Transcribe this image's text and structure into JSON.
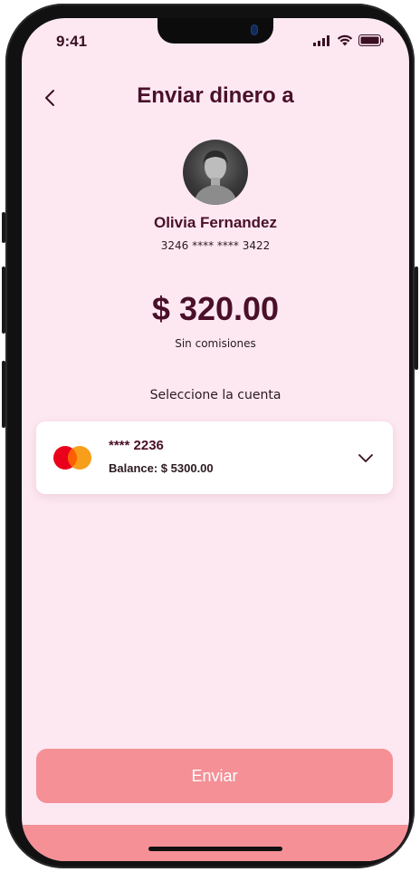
{
  "status_bar": {
    "time": "9:41",
    "icons": [
      "signal-icon",
      "wifi-icon",
      "battery-icon"
    ]
  },
  "header": {
    "title": "Enviar dinero a",
    "back_icon": "chevron-left-icon"
  },
  "recipient": {
    "name": "Olivia Fernandez",
    "account": "3246 **** **** 3422"
  },
  "transfer": {
    "amount": "$ 320.00",
    "fee_note": "Sin comisiones"
  },
  "account_select": {
    "label": "Seleccione la cuenta",
    "card_number": "**** 2236",
    "balance": "Balance: $ 5300.00",
    "card_brand_icon": "mastercard-icon",
    "dropdown_icon": "chevron-down-icon"
  },
  "actions": {
    "send_label": "Enviar"
  },
  "colors": {
    "background": "#fde8f1",
    "primary_text": "#4a1029",
    "button": "#f49096",
    "card": "#ffffff"
  }
}
